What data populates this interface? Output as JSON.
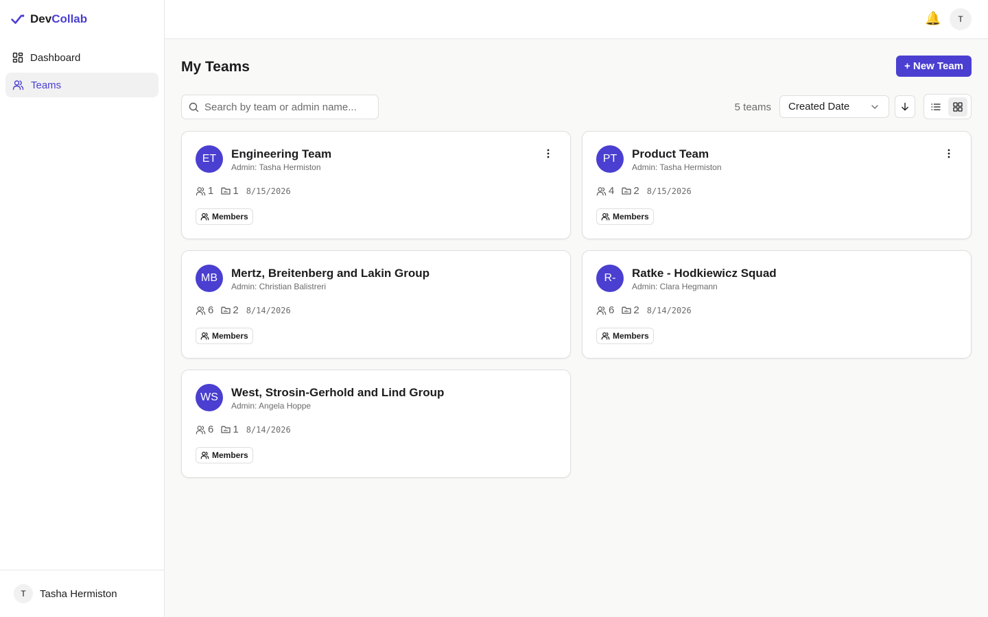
{
  "brand": {
    "name_part1": "Dev",
    "name_part2": "Collab"
  },
  "nav": {
    "items": [
      {
        "label": "Dashboard",
        "icon": "dashboard-grid-icon",
        "active": false
      },
      {
        "label": "Teams",
        "icon": "users-icon",
        "active": true
      }
    ]
  },
  "user": {
    "initial": "T",
    "name": "Tasha Hermiston"
  },
  "topbar": {
    "bell_icon": "🔔",
    "avatar_initial": "T"
  },
  "page": {
    "title": "My Teams",
    "new_team_label": "+ New Team",
    "search_placeholder": "Search by team or admin name...",
    "count_label": "5 teams",
    "sort_value": "Created Date",
    "sort_direction": "descending",
    "view_mode": "grid"
  },
  "colors": {
    "accent": "#4a3fd0",
    "sidebar_active_bg": "#f1f1f1"
  },
  "teams": [
    {
      "initials": "ET",
      "name": "Engineering Team",
      "admin": "Admin: Tasha Hermiston",
      "members": "1",
      "projects": "1",
      "date": "8/15/2026",
      "members_label": "Members",
      "has_menu": true
    },
    {
      "initials": "PT",
      "name": "Product Team",
      "admin": "Admin: Tasha Hermiston",
      "members": "4",
      "projects": "2",
      "date": "8/15/2026",
      "members_label": "Members",
      "has_menu": true
    },
    {
      "initials": "MB",
      "name": "Mertz, Breitenberg and Lakin Group",
      "admin": "Admin: Christian Balistreri",
      "members": "6",
      "projects": "2",
      "date": "8/14/2026",
      "members_label": "Members",
      "has_menu": false
    },
    {
      "initials": "R-",
      "name": "Ratke - Hodkiewicz Squad",
      "admin": "Admin: Clara Hegmann",
      "members": "6",
      "projects": "2",
      "date": "8/14/2026",
      "members_label": "Members",
      "has_menu": false
    },
    {
      "initials": "WS",
      "name": "West, Strosin-Gerhold and Lind Group",
      "admin": "Admin: Angela Hoppe",
      "members": "6",
      "projects": "1",
      "date": "8/14/2026",
      "members_label": "Members",
      "has_menu": false
    }
  ]
}
